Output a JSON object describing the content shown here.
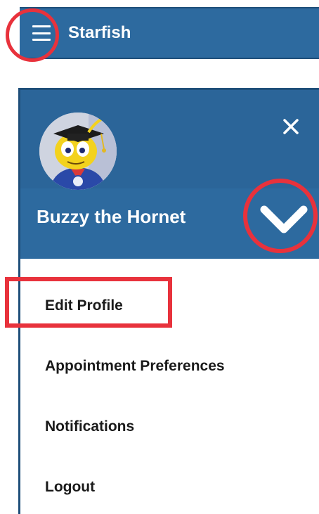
{
  "header": {
    "app_title": "Starfish",
    "menu_icon": "hamburger-menu-icon"
  },
  "drawer": {
    "user_name": "Buzzy the Hornet",
    "close_icon": "close-icon",
    "expand_icon": "chevron-down-icon",
    "avatar": "mascot-avatar",
    "menu_items": [
      {
        "label": "Edit Profile"
      },
      {
        "label": "Appointment Preferences"
      },
      {
        "label": "Notifications"
      },
      {
        "label": "Logout"
      }
    ]
  },
  "colors": {
    "brand_blue": "#2d6a9f",
    "highlight_red": "#e8323c"
  }
}
